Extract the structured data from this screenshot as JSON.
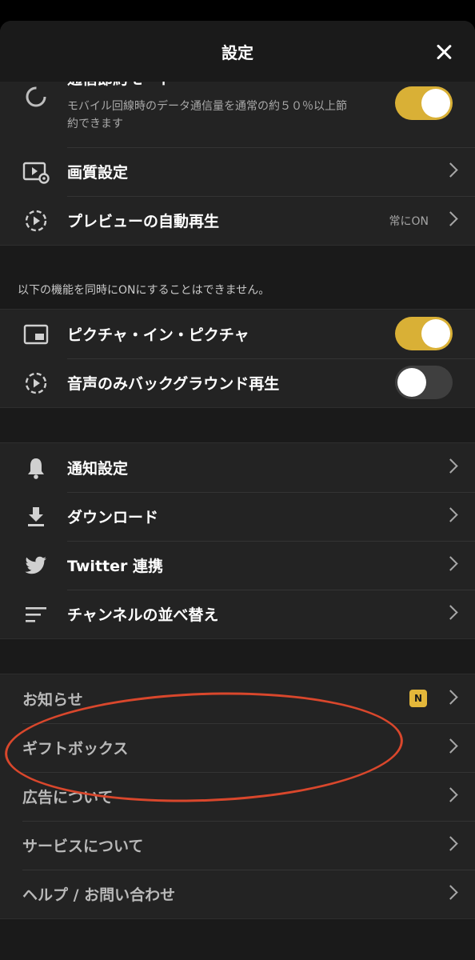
{
  "header": {
    "title": "設定"
  },
  "data_saver": {
    "title": "通信節約モード",
    "description_line1": "モバイル回線時のデータ通信量を通常の約５０％以上節",
    "description_line2": "約できます",
    "toggle": "on"
  },
  "video_group": {
    "items": [
      {
        "label": "画質設定",
        "icon": "video-settings-icon"
      },
      {
        "label": "プレビューの自動再生",
        "value": "常にON",
        "icon": "autoplay-icon"
      }
    ]
  },
  "exclusive_note": "以下の機能を同時にONにすることはできません。",
  "playback_group": {
    "items": [
      {
        "label": "ピクチャ・イン・ピクチャ",
        "toggle": "on",
        "icon": "picture-in-picture-icon"
      },
      {
        "label": "音声のみバックグラウンド再生",
        "toggle": "off",
        "icon": "background-audio-icon"
      }
    ]
  },
  "general_group": {
    "items": [
      {
        "label": "通知設定",
        "icon": "bell-icon"
      },
      {
        "label": "ダウンロード",
        "icon": "download-icon"
      },
      {
        "label": "Twitter 連携",
        "icon": "twitter-icon"
      },
      {
        "label": "チャンネルの並べ替え",
        "icon": "sort-icon"
      }
    ]
  },
  "info_group": {
    "items": [
      {
        "label": "お知らせ",
        "badge": "N"
      },
      {
        "label": "ギフトボックス"
      },
      {
        "label": "広告について"
      },
      {
        "label": "サービスについて"
      },
      {
        "label": "ヘルプ / お問い合わせ"
      }
    ]
  },
  "colors": {
    "accent_toggle": "#d9b036",
    "annotation_circle": "#d9472c",
    "badge": "#e4b73a"
  }
}
